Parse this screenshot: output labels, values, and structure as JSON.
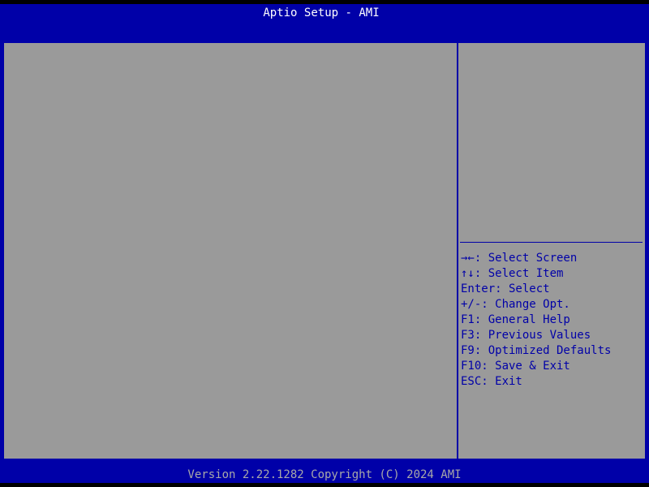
{
  "header": {
    "title": "Aptio Setup - AMI"
  },
  "help": {
    "description": ""
  },
  "key_legend": [
    "→←: Select Screen",
    "↑↓: Select Item",
    "Enter: Select",
    "+/-: Change Opt.",
    "F1: General Help",
    "F3: Previous Values",
    "F9: Optimized Defaults",
    "F10: Save & Exit",
    "ESC: Exit"
  ],
  "footer": {
    "version": "Version 2.22.1282 Copyright (C) 2024 AMI"
  },
  "colors": {
    "frame_blue": "#0000a8",
    "panel_gray": "#9a9a9a",
    "title_text": "#ffffff",
    "footer_text": "#a8a8a8",
    "help_text": "#0000a8"
  }
}
